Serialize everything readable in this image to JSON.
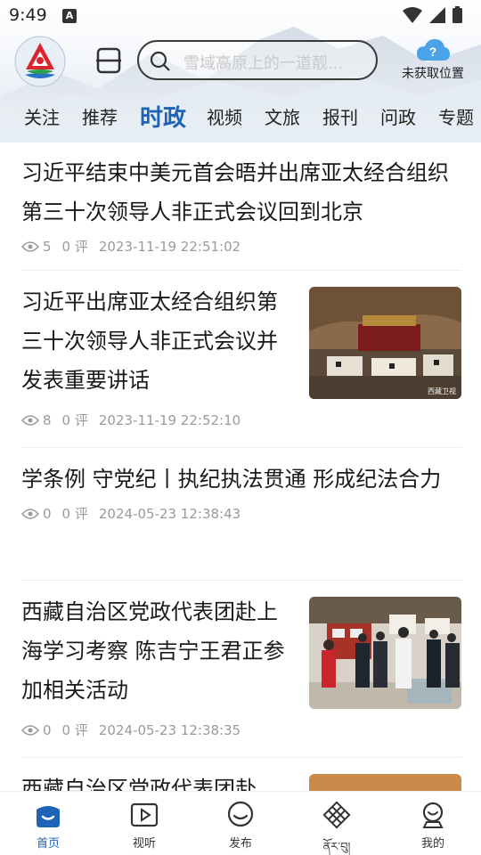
{
  "status_bar": {
    "time": "9:49",
    "badge": "A"
  },
  "header": {
    "search_placeholder": "雪域高原上的一道靓...",
    "weather_label": "未获取位置",
    "weather_icon": "cloud-question-icon",
    "scan_icon": "scan-icon",
    "logo_icon": "app-logo-icon"
  },
  "tabs": [
    {
      "label": "关注"
    },
    {
      "label": "推荐"
    },
    {
      "label": "时政",
      "active": true
    },
    {
      "label": "视频"
    },
    {
      "label": "文旅"
    },
    {
      "label": "报刊"
    },
    {
      "label": "问政"
    },
    {
      "label": "专题"
    }
  ],
  "articles": [
    {
      "title": "习近平结束中美元首会晤并出席亚太经合组织第三十次领导人非正式会议回到北京",
      "views": "5",
      "comments": "0 评",
      "time": "2023-11-19 22:51:02"
    },
    {
      "title": "习近平出席亚太经合组织第三十次领导人非正式会议并发表重要讲话",
      "views": "8",
      "comments": "0 评",
      "time": "2023-11-19 22:52:10",
      "image_label": "西藏卫视"
    },
    {
      "title": "学条例 守党纪丨执纪执法贯通 形成纪法合力",
      "views": "0",
      "comments": "0 评",
      "time": "2024-05-23 12:38:43"
    },
    {
      "title": "西藏自治区党政代表团赴上海学习考察 陈吉宁王君正参加相关活动",
      "views": "0",
      "comments": "0 评",
      "time": "2024-05-23 12:38:35"
    },
    {
      "title": "西藏自治区党政代表团赴"
    }
  ],
  "bottom_nav": [
    {
      "label": "首页",
      "icon": "home-icon",
      "active": true
    },
    {
      "label": "视听",
      "icon": "video-play-icon"
    },
    {
      "label": "发布",
      "icon": "chat-bubble-icon"
    },
    {
      "label": "ནོར་བུ།",
      "icon": "endless-knot-icon"
    },
    {
      "label": "我的",
      "icon": "profile-icon"
    }
  ],
  "colors": {
    "accent": "#1f63b8",
    "meta": "#9a9a9a",
    "placeholder": "#c9c9c9"
  }
}
